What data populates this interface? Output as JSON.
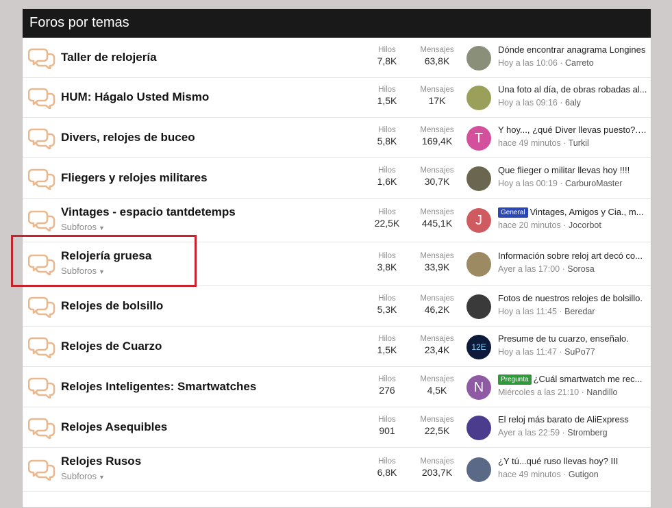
{
  "header": {
    "title": "Foros por temas"
  },
  "labels": {
    "hilos": "Hilos",
    "mensajes": "Mensajes",
    "subforos": "Subforos",
    "sep": "·"
  },
  "forums": [
    {
      "title": "Taller de relojería",
      "hilos": "7,8K",
      "mensajes": "63,8K",
      "last_title": "Dónde encontrar anagrama Longines",
      "last_time": "Hoy a las 10:06",
      "last_user": "Carreto",
      "avatar": {
        "letter": "",
        "color": "#8a8f7a"
      }
    },
    {
      "title": "HUM: Hágalo Usted Mismo",
      "hilos": "1,5K",
      "mensajes": "17K",
      "last_title": "Una foto al día, de obras robadas al...",
      "last_time": "Hoy a las 09:16",
      "last_user": "6aly",
      "avatar": {
        "letter": "",
        "color": "#9aa05a"
      }
    },
    {
      "title": "Divers, relojes de buceo",
      "hilos": "5,8K",
      "mensajes": "169,4K",
      "last_title": "Y hoy..., ¿qué Diver llevas puesto?. (...",
      "last_time": "hace 49 minutos",
      "last_user": "Turkil",
      "avatar": {
        "letter": "T",
        "color": "#d2509c"
      }
    },
    {
      "title": "Fliegers y relojes militares",
      "hilos": "1,6K",
      "mensajes": "30,7K",
      "last_title": "Que flieger o militar llevas hoy !!!!",
      "last_time": "Hoy a las 00:19",
      "last_user": "CarburoMaster",
      "avatar": {
        "letter": "",
        "color": "#6b6650"
      }
    },
    {
      "title": "Vintages - espacio tantdetemps",
      "hilos": "22,5K",
      "mensajes": "445,1K",
      "subforos": true,
      "badge": {
        "text": "General",
        "color": "#2a47b3"
      },
      "last_title": "Vintages, Amigos y Cia., m...",
      "last_time": "hace 20 minutos",
      "last_user": "Jocorbot",
      "avatar": {
        "letter": "J",
        "color": "#cf5a5f"
      }
    },
    {
      "title": "Relojería gruesa",
      "hilos": "3,8K",
      "mensajes": "33,9K",
      "subforos": true,
      "last_title": "Información sobre reloj art decó co...",
      "last_time": "Ayer a las 17:00",
      "last_user": "Sorosa",
      "avatar": {
        "letter": "",
        "color": "#9c8a63"
      }
    },
    {
      "title": "Relojes de bolsillo",
      "hilos": "5,3K",
      "mensajes": "46,2K",
      "last_title": "Fotos de nuestros relojes de bolsillo.",
      "last_time": "Hoy a las 11:45",
      "last_user": "Beredar",
      "avatar": {
        "letter": "",
        "color": "#3a3a3a"
      }
    },
    {
      "title": "Relojes de Cuarzo",
      "hilos": "1,5K",
      "mensajes": "23,4K",
      "last_title": "Presume de tu cuarzo, enseñalo.",
      "last_time": "Hoy a las 11:47",
      "last_user": "SuPo77",
      "avatar": {
        "letter": "12E",
        "color": "#0d1a3a"
      }
    },
    {
      "title": "Relojes Inteligentes: Smartwatches",
      "hilos": "276",
      "mensajes": "4,5K",
      "badge": {
        "text": "Pregunta",
        "color": "#2e9a3a"
      },
      "last_title": "¿Cuál smartwatch me rec...",
      "last_time": "Miércoles a las 21:10",
      "last_user": "Nandillo",
      "avatar": {
        "letter": "N",
        "color": "#8e5aa3"
      }
    },
    {
      "title": "Relojes Asequibles",
      "hilos": "901",
      "mensajes": "22,5K",
      "last_title": "El reloj más barato de AliExpress",
      "last_time": "Ayer a las 22:59",
      "last_user": "Stromberg",
      "avatar": {
        "letter": "",
        "color": "#4b3c8e"
      }
    },
    {
      "title": "Relojes Rusos",
      "hilos": "6,8K",
      "mensajes": "203,7K",
      "subforos": true,
      "last_title": "¿Y tú...qué ruso llevas hoy? III",
      "last_time": "hace 49 minutos",
      "last_user": "Gutigon",
      "avatar": {
        "letter": "",
        "color": "#5a6a86"
      }
    }
  ]
}
